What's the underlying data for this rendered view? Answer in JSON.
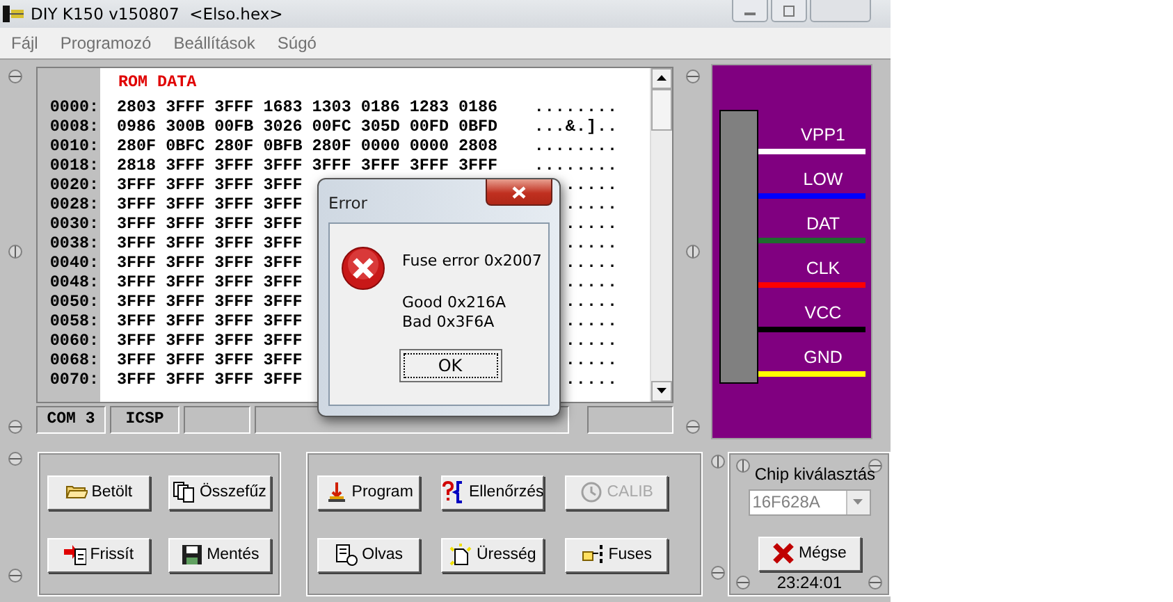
{
  "window": {
    "title": "DIY K150 v150807  <Elso.hex>"
  },
  "menu": [
    {
      "label": "Fájl"
    },
    {
      "label": "Programozó"
    },
    {
      "label": "Beállítások"
    },
    {
      "label": "Súgó"
    }
  ],
  "hex_view": {
    "heading": "ROM DATA",
    "rows": [
      {
        "address": "0000:",
        "words": "2803 3FFF 3FFF 1683 1303 0186 1283 0186",
        "ascii": "........"
      },
      {
        "address": "0008:",
        "words": "0986 300B 00FB 3026 00FC 305D 00FD 0BFD",
        "ascii": "...&.].."
      },
      {
        "address": "0010:",
        "words": "280F 0BFC 280F 0BFB 280F 0000 0000 2808",
        "ascii": "........"
      },
      {
        "address": "0018:",
        "words": "2818 3FFF 3FFF 3FFF 3FFF 3FFF 3FFF 3FFF",
        "ascii": "........"
      },
      {
        "address": "0020:",
        "words": "3FFF 3FFF 3FFF 3FFF",
        "ascii": "....."
      },
      {
        "address": "0028:",
        "words": "3FFF 3FFF 3FFF 3FFF",
        "ascii": "....."
      },
      {
        "address": "0030:",
        "words": "3FFF 3FFF 3FFF 3FFF",
        "ascii": "....."
      },
      {
        "address": "0038:",
        "words": "3FFF 3FFF 3FFF 3FFF",
        "ascii": "....."
      },
      {
        "address": "0040:",
        "words": "3FFF 3FFF 3FFF 3FFF",
        "ascii": "....."
      },
      {
        "address": "0048:",
        "words": "3FFF 3FFF 3FFF 3FFF",
        "ascii": "....."
      },
      {
        "address": "0050:",
        "words": "3FFF 3FFF 3FFF 3FFF",
        "ascii": "....."
      },
      {
        "address": "0058:",
        "words": "3FFF 3FFF 3FFF 3FFF",
        "ascii": "....."
      },
      {
        "address": "0060:",
        "words": "3FFF 3FFF 3FFF 3FFF",
        "ascii": "....."
      },
      {
        "address": "0068:",
        "words": "3FFF 3FFF 3FFF 3FFF",
        "ascii": "....."
      },
      {
        "address": "0070:",
        "words": "3FFF 3FFF 3FFF 3FFF",
        "ascii": "....."
      }
    ]
  },
  "status_bar": [
    {
      "text": "COM 3"
    },
    {
      "text": "ICSP"
    }
  ],
  "pins": [
    {
      "label": "VPP1",
      "color": "#ffffff"
    },
    {
      "label": "LOW",
      "color": "#0000ff"
    },
    {
      "label": "DAT",
      "color": "#1e6b2e"
    },
    {
      "label": "CLK",
      "color": "#ff0000"
    },
    {
      "label": "VCC",
      "color": "#000000"
    },
    {
      "label": "GND",
      "color": "#ffff00"
    }
  ],
  "file_buttons": [
    {
      "label": "Betölt",
      "kind": "open"
    },
    {
      "label": "Összefűz",
      "kind": "merge"
    },
    {
      "label": "Frissít",
      "kind": "refresh"
    },
    {
      "label": "Mentés",
      "kind": "save"
    }
  ],
  "device_buttons": [
    {
      "label": "Program",
      "kind": "program",
      "disabled": false
    },
    {
      "label": "Ellenőrzés",
      "kind": "verify",
      "disabled": false
    },
    {
      "label": "CALIB",
      "kind": "calib",
      "disabled": true
    },
    {
      "label": "Olvas",
      "kind": "read",
      "disabled": false
    },
    {
      "label": "Üresség",
      "kind": "blank",
      "disabled": false
    },
    {
      "label": "Fuses",
      "kind": "fuses",
      "disabled": false
    }
  ],
  "chip_select": {
    "label": "Chip kiválasztás",
    "value": "16F628A"
  },
  "cancel_button": {
    "label": "Mégse"
  },
  "clock": "23:24:01",
  "dialog": {
    "title": "Error",
    "message": "Fuse error 0x2007",
    "details": [
      "Good 0x216A",
      "Bad 0x3F6A"
    ],
    "button": "OK"
  }
}
